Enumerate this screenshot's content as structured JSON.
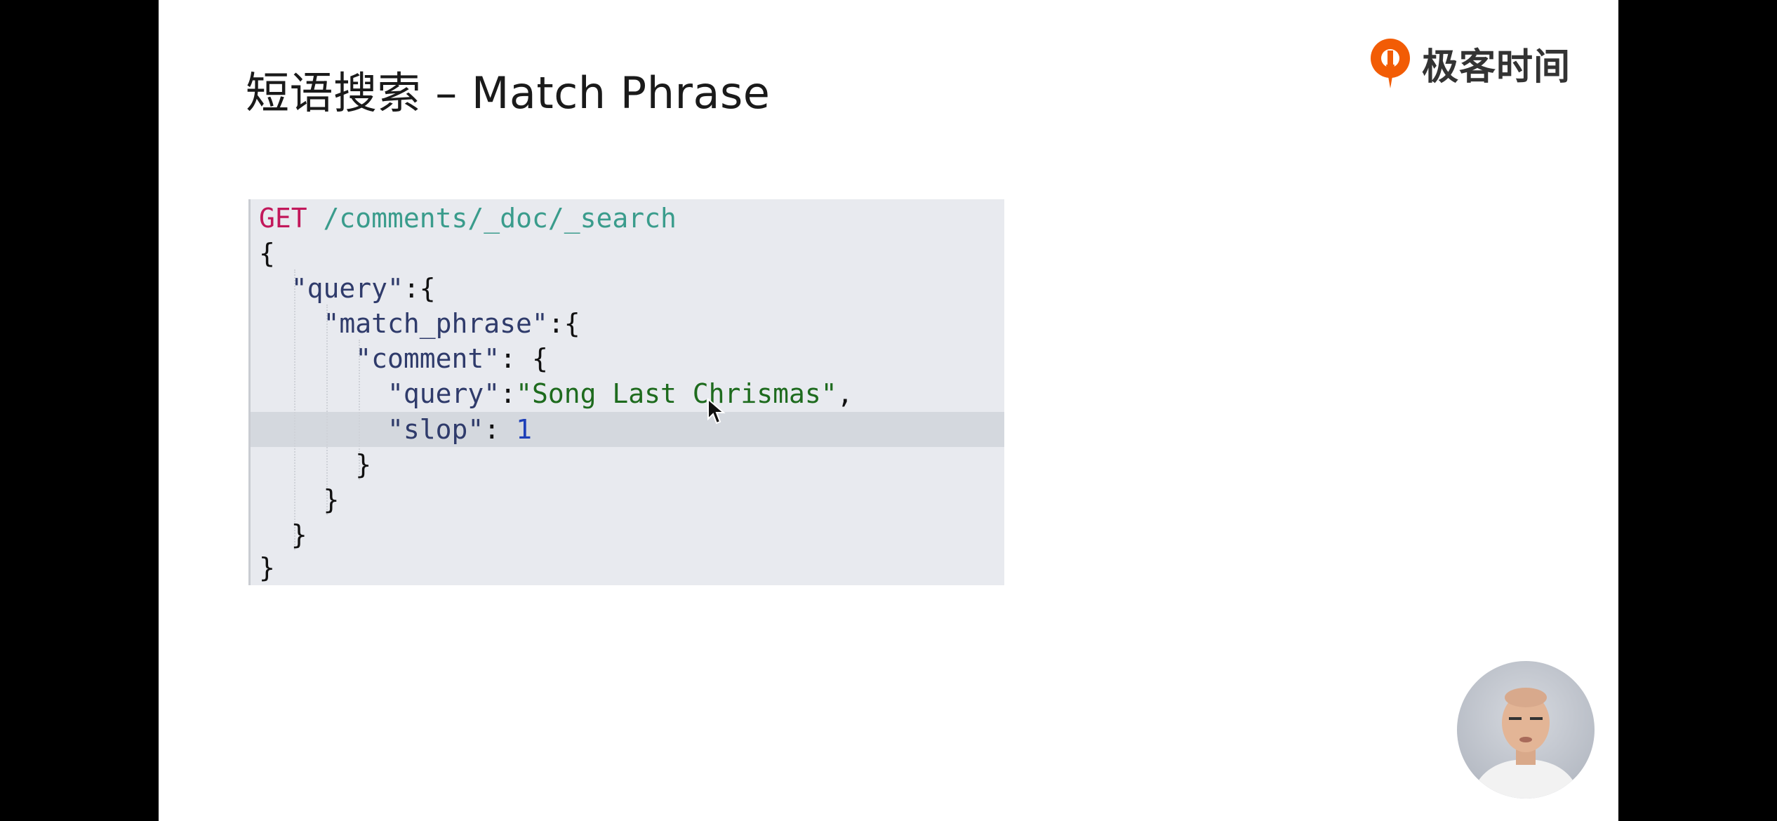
{
  "slide": {
    "title": "短语搜索 – Match Phrase",
    "logo_text": "极客时间"
  },
  "code": {
    "method": "GET",
    "path": "/comments/_doc/_search",
    "lines": [
      "{",
      "\"query\"",
      ":{",
      "\"match_phrase\"",
      ":{",
      "\"comment\"",
      ": {",
      "\"query\"",
      ":",
      "\"Song Last Chrismas\"",
      ",",
      "\"slop\"",
      ": ",
      "1",
      "}",
      "}",
      "}",
      "}"
    ]
  },
  "colors": {
    "background": "#000000",
    "slide": "#ffffff",
    "code_bg": "#e8eaef",
    "highlight_line": "#d4d8de",
    "method": "#c2185b",
    "path": "#3a9c8c",
    "string": "#1e6b1e",
    "number": "#1d3fb8",
    "logo_accent": "#f25c05"
  },
  "icons": {
    "logo": "geektime-logo-icon",
    "cursor": "mouse-pointer-icon",
    "presenter": "presenter-avatar"
  }
}
